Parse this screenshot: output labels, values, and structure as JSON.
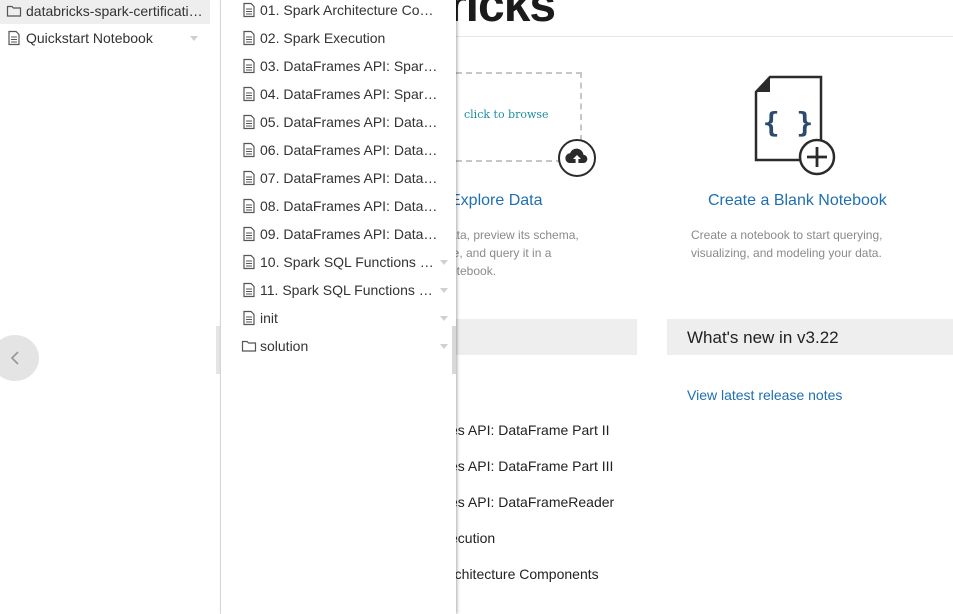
{
  "brand": {
    "text": "ricks"
  },
  "import": {
    "browse_text": "click to browse"
  },
  "explore": {
    "title": "Explore Data",
    "desc": [
      "ata, preview its schema,",
      "le, and query it in a",
      "otebook."
    ]
  },
  "blank_notebook": {
    "title": "Create a Blank Notebook",
    "desc": [
      "Create a notebook to start querying,",
      "visualizing, and modeling your data."
    ],
    "icon_text": "{ }"
  },
  "whats_new": {
    "title": "What's new in v3.22",
    "link": "View latest release notes"
  },
  "recents": [
    "es API: DataFrame Part II",
    "es API: DataFrame Part III",
    "es API: DataFrameReader",
    "ecution",
    "rchitecture Components"
  ],
  "workspace": {
    "items": [
      {
        "label": "databricks-spark-certificati…",
        "icon": "folder-icon",
        "selected": true
      },
      {
        "label": "Quickstart Notebook",
        "icon": "notebook-icon",
        "selected": false
      }
    ]
  },
  "folder_contents": [
    {
      "label": "01. Spark Architecture Co…",
      "icon": "notebook-icon"
    },
    {
      "label": "02. Spark Execution",
      "icon": "notebook-icon"
    },
    {
      "label": "03. DataFrames API: Spar…",
      "icon": "notebook-icon"
    },
    {
      "label": "04. DataFrames API: Spar…",
      "icon": "notebook-icon"
    },
    {
      "label": "05. DataFrames API: Data…",
      "icon": "notebook-icon"
    },
    {
      "label": "06. DataFrames API: Data…",
      "icon": "notebook-icon"
    },
    {
      "label": "07. DataFrames API: Data…",
      "icon": "notebook-icon"
    },
    {
      "label": "08. DataFrames API: Data…",
      "icon": "notebook-icon"
    },
    {
      "label": "09. DataFrames API: Data…",
      "icon": "notebook-icon"
    },
    {
      "label": "10. Spark SQL Functions …",
      "icon": "notebook-icon"
    },
    {
      "label": "11. Spark SQL Functions …",
      "icon": "notebook-icon"
    },
    {
      "label": "init",
      "icon": "notebook-icon"
    },
    {
      "label": "solution",
      "icon": "folder-icon"
    }
  ],
  "colors": {
    "link": "#1f6fb0",
    "accent_teal": "#1f8ca0",
    "panel_bg": "#eeeeee"
  }
}
